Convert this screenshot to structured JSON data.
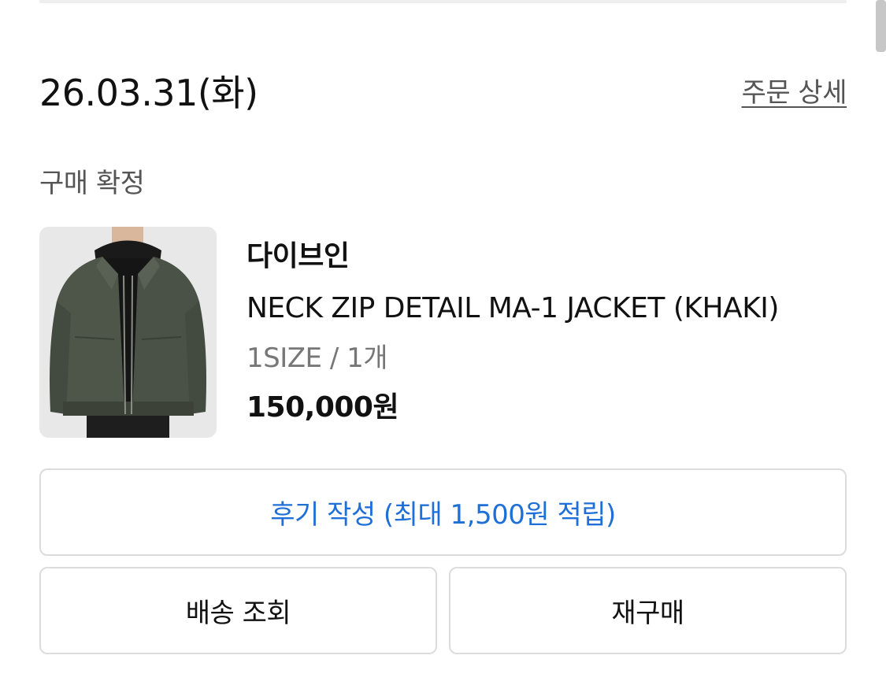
{
  "order": {
    "date": "26.03.31(화)",
    "detail_link": "주문 상세",
    "status": "구매 확정"
  },
  "product": {
    "brand": "다이브인",
    "name": "NECK ZIP DETAIL MA-1 JACKET (KHAKI)",
    "option": "1SIZE / 1개",
    "price": "150,000원",
    "image_icon": "product-thumbnail"
  },
  "actions": {
    "review_label": "후기 작성 (최대 1,500원 적립)",
    "shipping_label": "배송 조회",
    "rebuy_label": "재구매"
  },
  "colors": {
    "accent": "#1f6fd8",
    "text_primary": "#111111",
    "text_secondary": "#555555",
    "border": "#dcdcdc"
  }
}
